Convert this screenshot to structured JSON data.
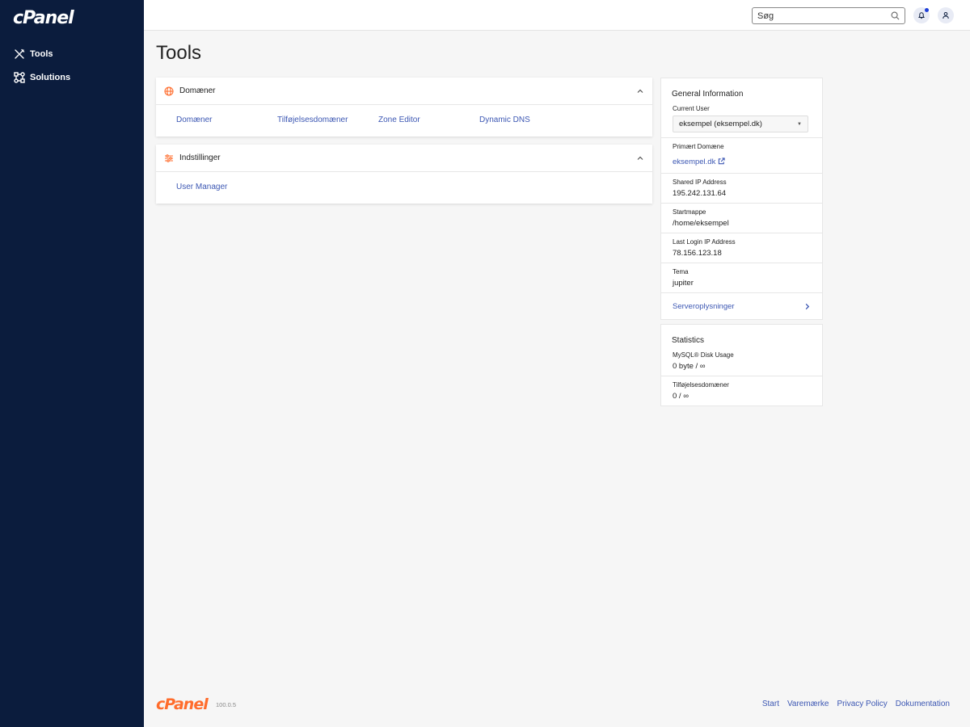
{
  "brand": {
    "logo_text": "cPanel",
    "version": "100.0.5",
    "accent": "#ff6c2c",
    "sidebar_bg": "#0b1c3d",
    "link_color": "#3c57b3"
  },
  "sidebar": {
    "items": [
      {
        "label": "Tools",
        "icon": "tools-icon"
      },
      {
        "label": "Solutions",
        "icon": "solutions-icon"
      }
    ]
  },
  "topbar": {
    "search_placeholder": "Søg"
  },
  "page": {
    "title": "Tools"
  },
  "panels": {
    "domains": {
      "title": "Domæner",
      "links": [
        "Domæner",
        "Tilføjelsesdomæner",
        "Zone Editor",
        "Dynamic DNS"
      ]
    },
    "settings": {
      "title": "Indstillinger",
      "links": [
        "User Manager"
      ]
    }
  },
  "general_info": {
    "title": "General Information",
    "current_user_label": "Current User",
    "current_user_value": "eksempel (eksempel.dk)",
    "primary_domain_label": "Primært Domæne",
    "primary_domain_value": "eksempel.dk",
    "shared_ip_label": "Shared IP Address",
    "shared_ip_value": "195.242.131.64",
    "home_dir_label": "Startmappe",
    "home_dir_value": "/home/eksempel",
    "last_login_label": "Last Login IP Address",
    "last_login_value": "78.156.123.18",
    "theme_label": "Tema",
    "theme_value": "jupiter",
    "server_info_link": "Serveroplysninger"
  },
  "statistics": {
    "title": "Statistics",
    "mysql_label": "MySQL® Disk Usage",
    "mysql_value": "0 byte / ∞",
    "addon_label": "Tilføjelsesdomæner",
    "addon_value": "0 / ∞"
  },
  "footer": {
    "links": [
      "Start",
      "Varemærke",
      "Privacy Policy",
      "Dokumentation"
    ]
  }
}
